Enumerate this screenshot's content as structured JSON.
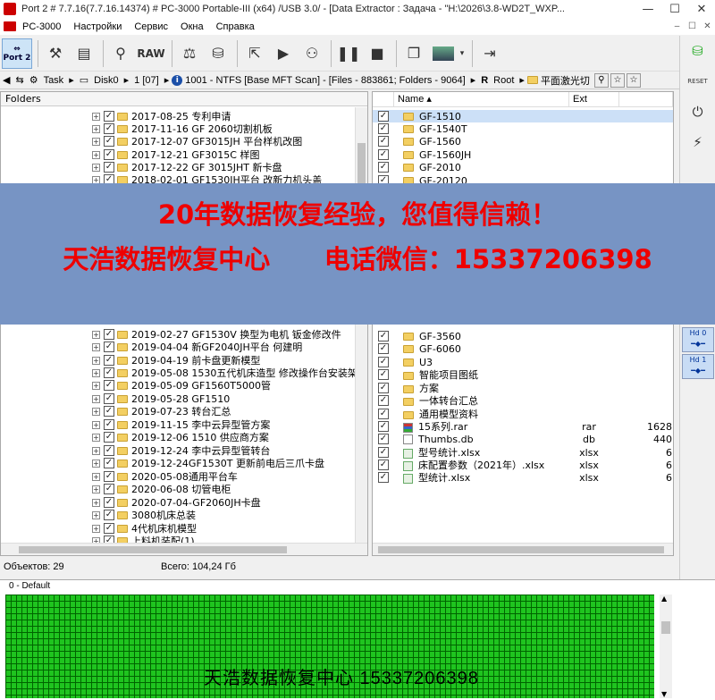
{
  "window": {
    "title": "Port 2 # 7.7.16(7.7.16.14374) # PC-3000 Portable-III (x64) /USB 3.0/ - [Data Extractor : Задача - \"H:\\2026\\3.8-WD2T_WXP...",
    "minimize": "—",
    "maximize": "☐",
    "close": "✕"
  },
  "menu": {
    "items": [
      "PC-3000",
      "Настройки",
      "Сервис",
      "Окна",
      "Справка"
    ],
    "mdi_min": "–",
    "mdi_max": "☐",
    "mdi_close": "✕"
  },
  "toolbar": {
    "port_label": "Port 2",
    "raw_label": "RAW"
  },
  "address": {
    "task": "Task",
    "disk": "Disk0",
    "part": "1 [07]",
    "info": "1001 - NTFS [Base MFT Scan] - [Files - 883861; Folders - 9064]",
    "root": "Root",
    "folder": "平面激光切"
  },
  "folders_panel": {
    "header": "Folders",
    "rows": [
      "2017-08-25 专利申请",
      "2017-11-16 GF 2060切割机板",
      "2017-12-07 GF3015JH 平台样机改图",
      "2017-12-21 GF3015C 样图",
      "2017-12-22 GF 3015JHT 新卡盘",
      "2018-02-01 GF1530JH平台 改新力机头盖",
      "2019-02-27 GF1530V 换型为电机 钣金修改件",
      "2019-04-04 新GF2040JH平台 何建明",
      "2019-04-19 前卡盘更新模型",
      "2019-05-08 1530五代机床造型 修改操作台安装架",
      "2019-05-09 GF1560T5000管",
      "2019-05-28 GF1510",
      "2019-07-23 转台汇总",
      "2019-11-15 李中云异型管方案",
      "2019-12-06 1510 供应商方案",
      "2019-12-24 李中云异型管转台",
      "2019-12-24GF1530T 更新前电后三爪卡盘",
      "2020-05-08通用平台车",
      "2020-06-08 切管电柜",
      "2020-07-04-GF2060JH卡盘",
      "3080机床总装",
      "4代机床机模型",
      "上料机装配(1)"
    ]
  },
  "files_panel": {
    "col_name": "Name",
    "col_ext": "Ext",
    "rows": [
      {
        "name": "GF-1510",
        "ext": "",
        "size": ""
      },
      {
        "name": "GF-1540T",
        "ext": "",
        "size": ""
      },
      {
        "name": "GF-1560",
        "ext": "",
        "size": ""
      },
      {
        "name": "GF-1560JH",
        "ext": "",
        "size": ""
      },
      {
        "name": "GF-2010",
        "ext": "",
        "size": ""
      },
      {
        "name": "GF-20120",
        "ext": "",
        "size": ""
      },
      {
        "name": "GF-3560",
        "ext": "",
        "size": ""
      },
      {
        "name": "GF-6060",
        "ext": "",
        "size": ""
      },
      {
        "name": "U3",
        "ext": "",
        "size": ""
      },
      {
        "name": "智能项目图纸",
        "ext": "",
        "size": ""
      },
      {
        "name": "方案",
        "ext": "",
        "size": ""
      },
      {
        "name": "一体转台汇总",
        "ext": "",
        "size": ""
      },
      {
        "name": "通用模型资料",
        "ext": "",
        "size": ""
      },
      {
        "name": "15系列.rar",
        "ext": "rar",
        "size": "1628"
      },
      {
        "name": "Thumbs.db",
        "ext": "db",
        "size": "440"
      },
      {
        "name": "型号统计.xlsx",
        "ext": "xlsx",
        "size": "6"
      },
      {
        "name": "床配置参数（2021年）.xlsx",
        "ext": "xlsx",
        "size": "6"
      },
      {
        "name": "型统计.xlsx",
        "ext": "xlsx",
        "size": "6"
      }
    ]
  },
  "status": {
    "objects": "Объектов: 29",
    "total": "Всего: 104,24 Гб"
  },
  "map": {
    "label": "0 - Default",
    "up": "▲",
    "down": "▼"
  },
  "banner": {
    "line1": "20年数据恢复经验，您值得信赖！",
    "line2": "天浩数据恢复中心      电话微信：15337206398"
  },
  "watermark": "天浩数据恢复中心 15337206398",
  "side": {
    "reset": "RESET",
    "hd0": "Hd 0",
    "hd1": "Hd 1"
  },
  "colors": {
    "banner_bg": "#7794c4",
    "banner_text": "#ee0000",
    "map_cell": "#1fc41f",
    "selection": "#cce0f7"
  }
}
